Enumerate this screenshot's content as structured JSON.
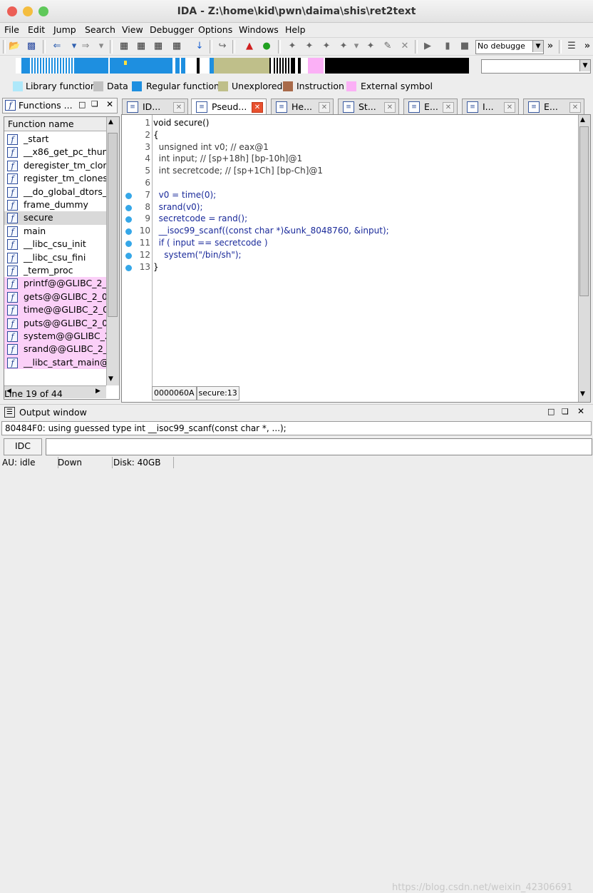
{
  "window": {
    "title": "IDA - Z:\\home\\kid\\pwn\\daima\\shis\\ret2text"
  },
  "menu": [
    "File",
    "Edit",
    "Jump",
    "Search",
    "View",
    "Debugger",
    "Options",
    "Windows",
    "Help"
  ],
  "toolbar": {
    "debugger_select": "No debugge"
  },
  "legend": [
    {
      "label": "Library function",
      "color": "#aee8fa"
    },
    {
      "label": "Data",
      "color": "#c0c0c0"
    },
    {
      "label": "Regular function",
      "color": "#1e8fe0"
    },
    {
      "label": "Unexplored",
      "color": "#bfbf8a"
    },
    {
      "label": "Instruction",
      "color": "#a86a4a"
    },
    {
      "label": "External symbol",
      "color": "#fbb0f6"
    }
  ],
  "functions_panel": {
    "title": "Functions ...",
    "column": "Function name",
    "items": [
      {
        "name": "_start",
        "external": false
      },
      {
        "name": "__x86_get_pc_thun",
        "external": false
      },
      {
        "name": "deregister_tm_clon",
        "external": false
      },
      {
        "name": "register_tm_clones",
        "external": false
      },
      {
        "name": "__do_global_dtors_",
        "external": false
      },
      {
        "name": "frame_dummy",
        "external": false
      },
      {
        "name": "secure",
        "external": false
      },
      {
        "name": "main",
        "external": false
      },
      {
        "name": "__libc_csu_init",
        "external": false
      },
      {
        "name": "__libc_csu_fini",
        "external": false
      },
      {
        "name": "_term_proc",
        "external": false
      },
      {
        "name": "printf@@GLIBC_2_",
        "external": true
      },
      {
        "name": "gets@@GLIBC_2_0",
        "external": true
      },
      {
        "name": "time@@GLIBC_2_0",
        "external": true
      },
      {
        "name": "puts@@GLIBC_2_0",
        "external": true
      },
      {
        "name": "system@@GLIBC_2",
        "external": true
      },
      {
        "name": "srand@@GLIBC_2_",
        "external": true
      },
      {
        "name": "__libc_start_main@",
        "external": true
      }
    ],
    "status": "Line 19 of 44"
  },
  "tabs": [
    {
      "label": "ID...",
      "icon": "ida-view-icon"
    },
    {
      "label": "Pseud...",
      "icon": "pseudocode-icon",
      "active": true
    },
    {
      "label": "He...",
      "icon": "hex-view-icon"
    },
    {
      "label": "St...",
      "icon": "structures-icon"
    },
    {
      "label": "E...",
      "icon": "enums-icon"
    },
    {
      "label": "I...",
      "icon": "imports-icon"
    },
    {
      "label": "E...",
      "icon": "exports-icon"
    }
  ],
  "code": {
    "line_numbers": [
      "1",
      "2",
      "3",
      "4",
      "5",
      "6",
      "7",
      "8",
      "9",
      "10",
      "11",
      "12",
      "13"
    ],
    "lines": [
      [
        "void secure()"
      ],
      [
        "{"
      ],
      [
        "  unsigned int v0; // eax@1"
      ],
      [
        "  int input; // [sp+18h] [bp-10h]@1"
      ],
      [
        "  int secretcode; // [sp+1Ch] [bp-Ch]@1"
      ],
      [
        ""
      ],
      [
        "  v0 = time(0);"
      ],
      [
        "  srand(v0);"
      ],
      [
        "  secretcode = rand();"
      ],
      [
        "  __isoc99_scanf((const char *)&unk_8048760, &input);"
      ],
      [
        "  if ( input == secretcode )"
      ],
      [
        "    system(\"/bin/sh\");"
      ],
      [
        "}"
      ]
    ],
    "location": "0000060A",
    "location_func": "secure:13"
  },
  "output": {
    "title": "Output window",
    "text": "80484F0: using guessed type int __isoc99_scanf(const char *, ...);",
    "idc_label": "IDC"
  },
  "status": {
    "au": "AU:  idle",
    "direction": "Down",
    "disk": "Disk: 40GB"
  },
  "watermark": "https://blog.csdn.net/weixin_42306691"
}
